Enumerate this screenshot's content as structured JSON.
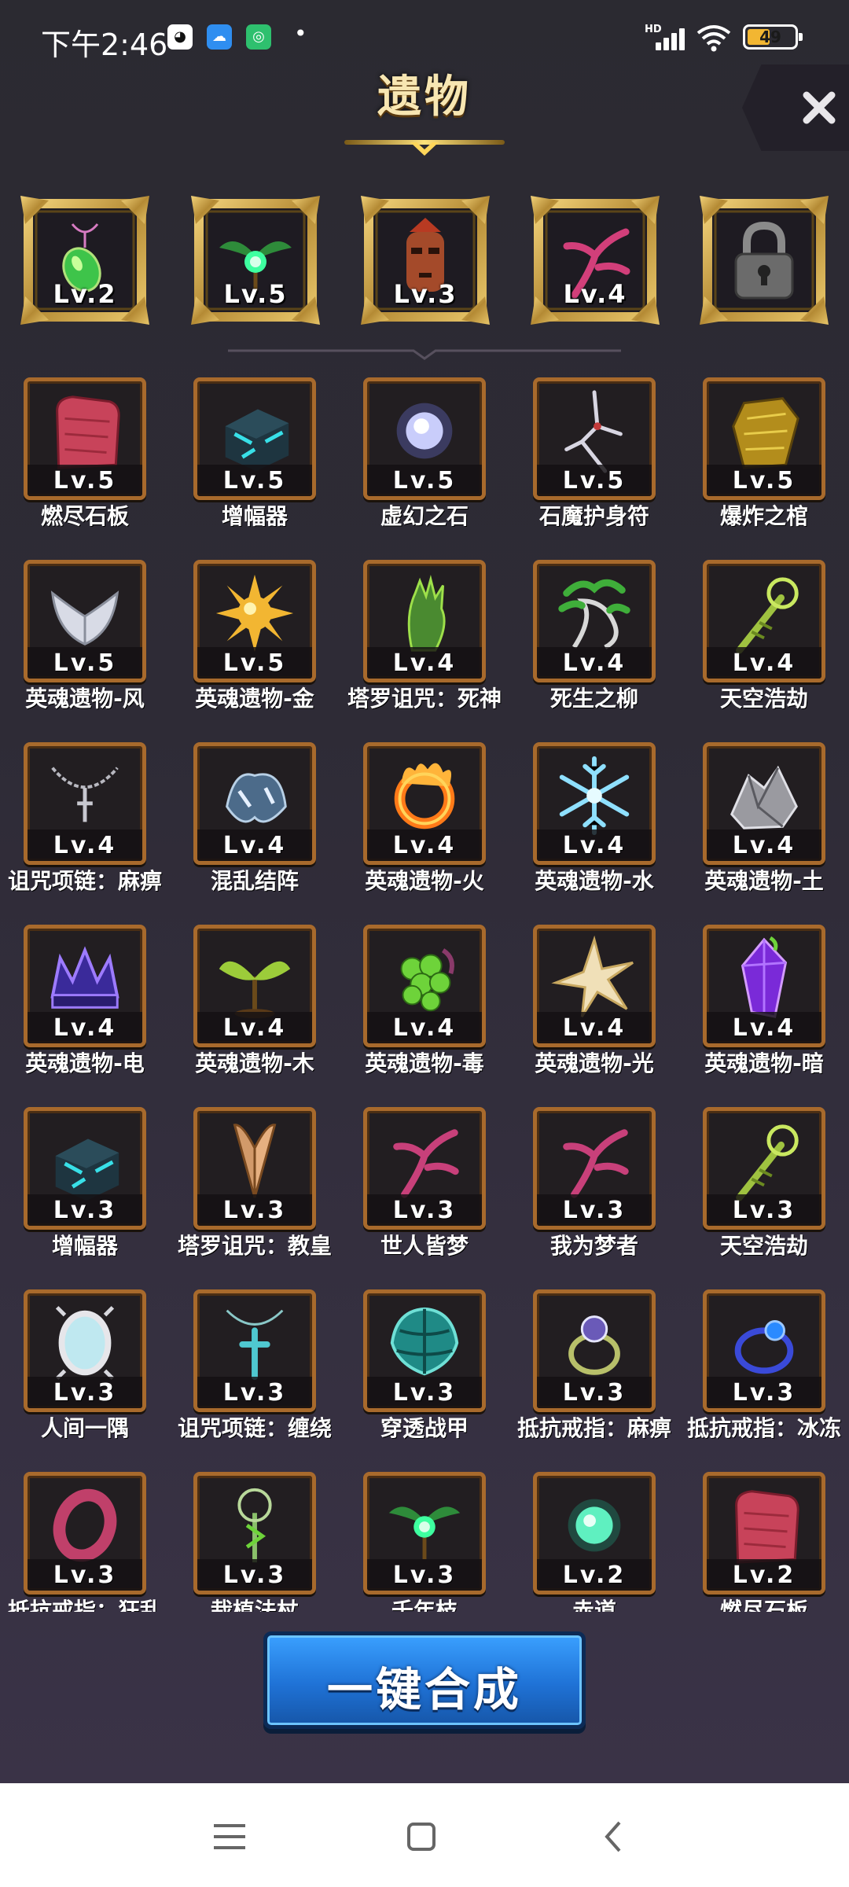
{
  "status_bar": {
    "time": "下午2:46",
    "apps": [
      "qq-icon",
      "cloud-icon",
      "green-app-icon"
    ],
    "network": "HD",
    "battery": "49",
    "battery_level": 0.49,
    "battery_color": "#f2b632"
  },
  "header": {
    "title": "遗物",
    "close_icon": "close-icon"
  },
  "equipped": [
    {
      "level": "Lv.2",
      "icon": "green-pendant-icon"
    },
    {
      "level": "Lv.5",
      "icon": "emerald-sprout-icon"
    },
    {
      "level": "Lv.3",
      "icon": "tribal-mask-icon"
    },
    {
      "level": "Lv.4",
      "icon": "pink-tree-icon"
    },
    {
      "level": "",
      "icon": "lock-icon",
      "locked": true
    }
  ],
  "relics": [
    {
      "name": "燃尽石板",
      "level": "Lv.5",
      "icon": "red-tablet-icon"
    },
    {
      "name": "增幅器",
      "level": "Lv.5",
      "icon": "cyan-cube-icon"
    },
    {
      "name": "虚幻之石",
      "level": "Lv.5",
      "icon": "glowing-orb-icon"
    },
    {
      "name": "石魔护身符",
      "level": "Lv.5",
      "icon": "bone-amulet-icon"
    },
    {
      "name": "爆炸之棺",
      "level": "Lv.5",
      "icon": "gold-coffin-icon"
    },
    {
      "name": "英魂遗物-风",
      "level": "Lv.5",
      "icon": "wind-wings-icon"
    },
    {
      "name": "英魂遗物-金",
      "level": "Lv.5",
      "icon": "gold-sun-icon"
    },
    {
      "name": "塔罗诅咒：死神",
      "level": "Lv.4",
      "icon": "death-hand-icon"
    },
    {
      "name": "死生之柳",
      "level": "Lv.4",
      "icon": "willow-icon"
    },
    {
      "name": "天空浩劫",
      "level": "Lv.4",
      "icon": "sky-staff-icon"
    },
    {
      "name": "诅咒项链：麻痹",
      "level": "Lv.4",
      "icon": "chain-necklace-icon"
    },
    {
      "name": "混乱结阵",
      "level": "Lv.4",
      "icon": "chaos-formation-icon"
    },
    {
      "name": "英魂遗物-火",
      "level": "Lv.4",
      "icon": "fire-ring-icon"
    },
    {
      "name": "英魂遗物-水",
      "level": "Lv.4",
      "icon": "snowflake-icon"
    },
    {
      "name": "英魂遗物-土",
      "level": "Lv.4",
      "icon": "earth-rock-icon"
    },
    {
      "name": "英魂遗物-电",
      "level": "Lv.4",
      "icon": "thunder-crown-icon"
    },
    {
      "name": "英魂遗物-木",
      "level": "Lv.4",
      "icon": "wood-sprout-icon"
    },
    {
      "name": "英魂遗物-毒",
      "level": "Lv.4",
      "icon": "poison-grapes-icon"
    },
    {
      "name": "英魂遗物-光",
      "level": "Lv.4",
      "icon": "light-star-icon"
    },
    {
      "name": "英魂遗物-暗",
      "level": "Lv.4",
      "icon": "dark-crystal-icon"
    },
    {
      "name": "增幅器",
      "level": "Lv.3",
      "icon": "cyan-cube-icon"
    },
    {
      "name": "塔罗诅咒：教皇",
      "level": "Lv.3",
      "icon": "pope-wings-icon"
    },
    {
      "name": "世人皆梦",
      "level": "Lv.3",
      "icon": "pink-tree-icon"
    },
    {
      "name": "我为梦者",
      "level": "Lv.3",
      "icon": "pink-tree-icon"
    },
    {
      "name": "天空浩劫",
      "level": "Lv.3",
      "icon": "sky-staff-icon"
    },
    {
      "name": "人间一隅",
      "level": "Lv.3",
      "icon": "silver-mirror-icon"
    },
    {
      "name": "诅咒项链：缠绕",
      "level": "Lv.3",
      "icon": "cross-necklace-icon"
    },
    {
      "name": "穿透战甲",
      "level": "Lv.3",
      "icon": "teal-armor-icon"
    },
    {
      "name": "抵抗戒指：麻痹",
      "level": "Lv.3",
      "icon": "gem-ring-icon"
    },
    {
      "name": "抵抗戒指：冰冻",
      "level": "Lv.3",
      "icon": "blue-ring-icon"
    },
    {
      "name": "抵抗戒指：狂乱",
      "level": "Lv.3",
      "icon": "red-ring-icon"
    },
    {
      "name": "栽植法杖",
      "level": "Lv.3",
      "icon": "planting-staff-icon"
    },
    {
      "name": "千年枝",
      "level": "Lv.3",
      "icon": "emerald-sprout-icon"
    },
    {
      "name": "赤道",
      "level": "Lv.2",
      "icon": "green-orb-icon"
    },
    {
      "name": "燃尽石板",
      "level": "Lv.2",
      "icon": "red-tablet-icon"
    }
  ],
  "actions": {
    "synthesize_label": "一键合成"
  },
  "system_nav": {
    "menu_icon": "menu-icon",
    "home_icon": "home-icon",
    "back_icon": "back-icon"
  },
  "colors": {
    "frame_bronze": "#a86a2c",
    "gold_frame": "#c9a24a",
    "button_blue": "#1f72d6"
  }
}
